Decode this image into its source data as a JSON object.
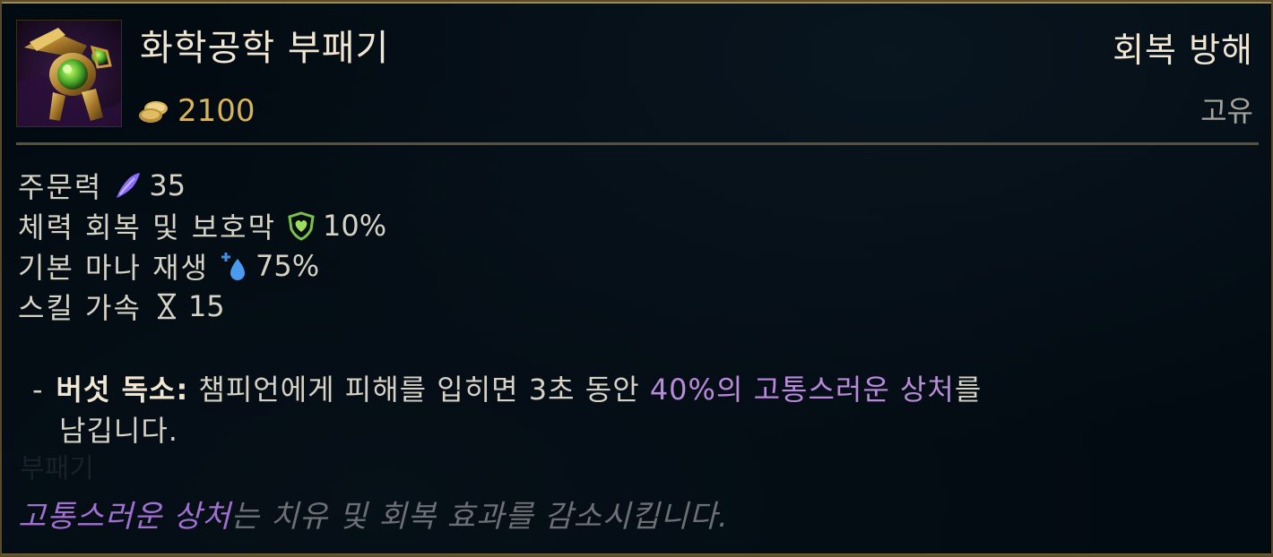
{
  "item": {
    "name": "화학공학 부패기",
    "cost": "2100",
    "icon": "chemtech-putrifier-icon"
  },
  "tags": {
    "main": "회복 방해",
    "sub": "고유"
  },
  "stats": [
    {
      "label": "주문력",
      "icon": "ability-power-icon",
      "value": "35"
    },
    {
      "label": "체력 회복 및 보호막",
      "icon": "heal-shield-power-icon",
      "value": "10%"
    },
    {
      "label": "기본 마나 재생",
      "icon": "mana-regen-icon",
      "value": "75%"
    },
    {
      "label": "스킬 가속",
      "icon": "ability-haste-icon",
      "value": "15"
    }
  ],
  "passive": {
    "dash": "-",
    "name": "버섯 독소:",
    "text_before": " 챔피언에게 피해를 입히면 3초 동안 ",
    "highlight_pct": "40%의 ",
    "highlight_term": "고통스러운 상처",
    "text_after": "를",
    "line2": "남깁니다."
  },
  "ghost_text": "부패기",
  "flavor": {
    "term": "고통스러운 상처",
    "text": "는 치유 및 회복 효과를 감소시킵니다."
  },
  "colors": {
    "gold": "#d8b458",
    "highlight": "#b98ad9",
    "border": "#a08a52",
    "background": "#030b12"
  }
}
